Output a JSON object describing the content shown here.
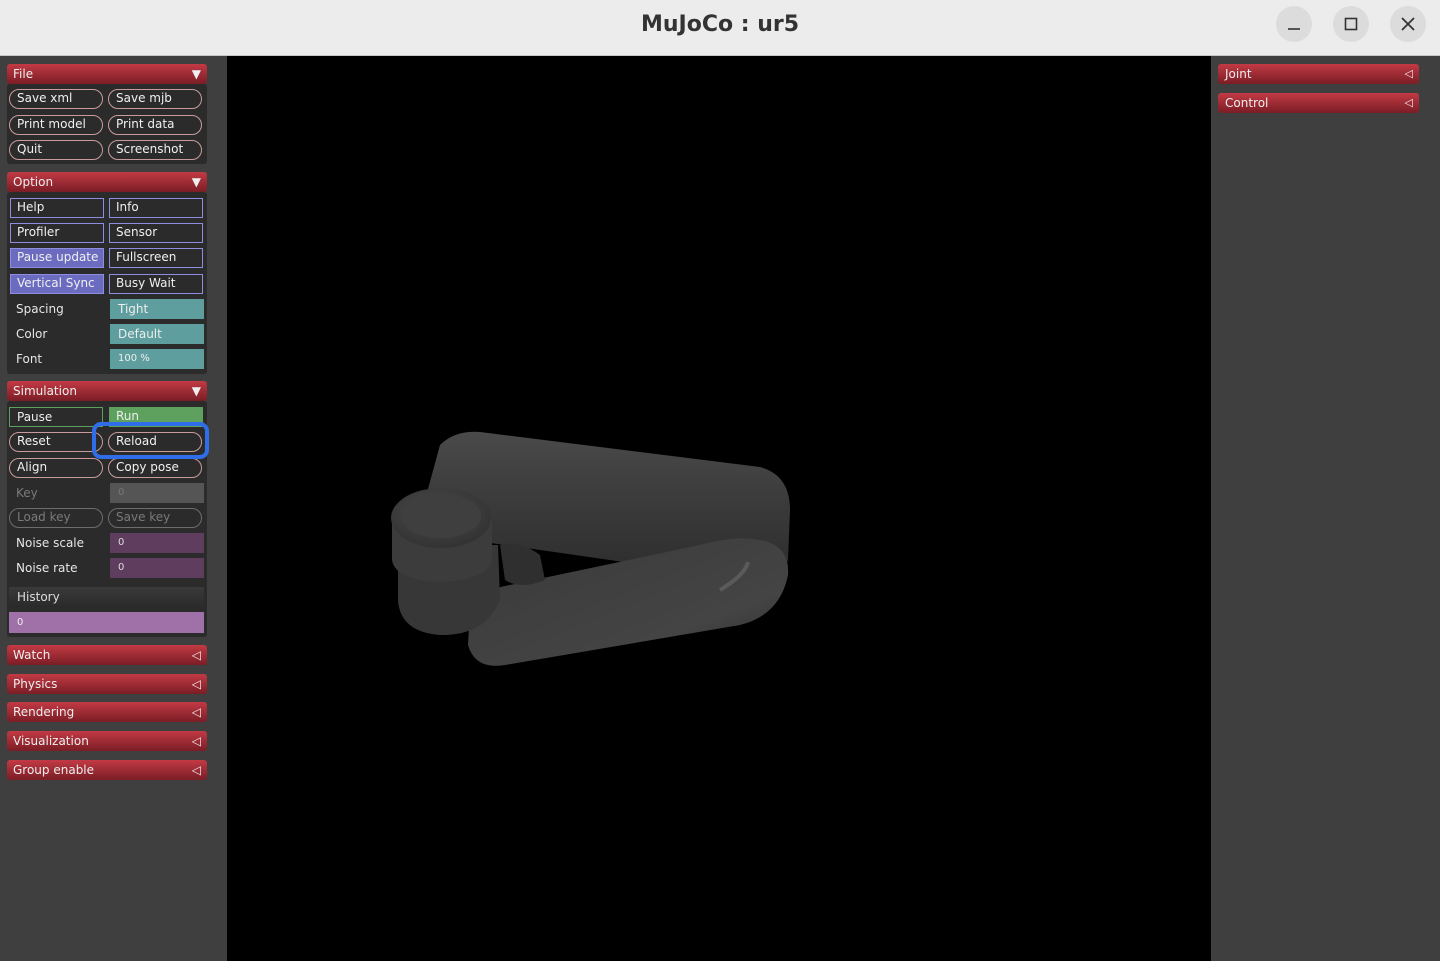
{
  "window": {
    "title": "MuJoCo : ur5"
  },
  "left": {
    "file": {
      "title": "File",
      "buttons": [
        "Save xml",
        "Save mjb",
        "Print model",
        "Print data",
        "Quit",
        "Screenshot"
      ]
    },
    "option": {
      "title": "Option",
      "toggles": [
        "Help",
        "Info",
        "Profiler",
        "Sensor",
        "Pause update",
        "Fullscreen",
        "Vertical Sync",
        "Busy Wait"
      ],
      "spacing": {
        "label": "Spacing",
        "value": "Tight"
      },
      "color": {
        "label": "Color",
        "value": "Default"
      },
      "font": {
        "label": "Font",
        "value": "100 %"
      }
    },
    "simulation": {
      "title": "Simulation",
      "pause": "Pause",
      "run": "Run",
      "reset": "Reset",
      "reload": "Reload",
      "align": "Align",
      "copy_pose": "Copy pose",
      "key": {
        "label": "Key",
        "value": "0"
      },
      "load_key": "Load key",
      "save_key": "Save key",
      "noise_scale": {
        "label": "Noise scale",
        "value": "0"
      },
      "noise_rate": {
        "label": "Noise rate",
        "value": "0"
      },
      "history": {
        "label": "History",
        "value": "0"
      }
    },
    "collapsed": [
      "Watch",
      "Physics",
      "Rendering",
      "Visualization",
      "Group enable"
    ]
  },
  "right": {
    "sections": [
      "Joint",
      "Control"
    ]
  },
  "colors": {
    "accent_red": "#c23a44",
    "highlight_blue": "#2f6ee8",
    "checked_blue": "#6b6bc0",
    "select_teal": "#5e9e9e"
  }
}
